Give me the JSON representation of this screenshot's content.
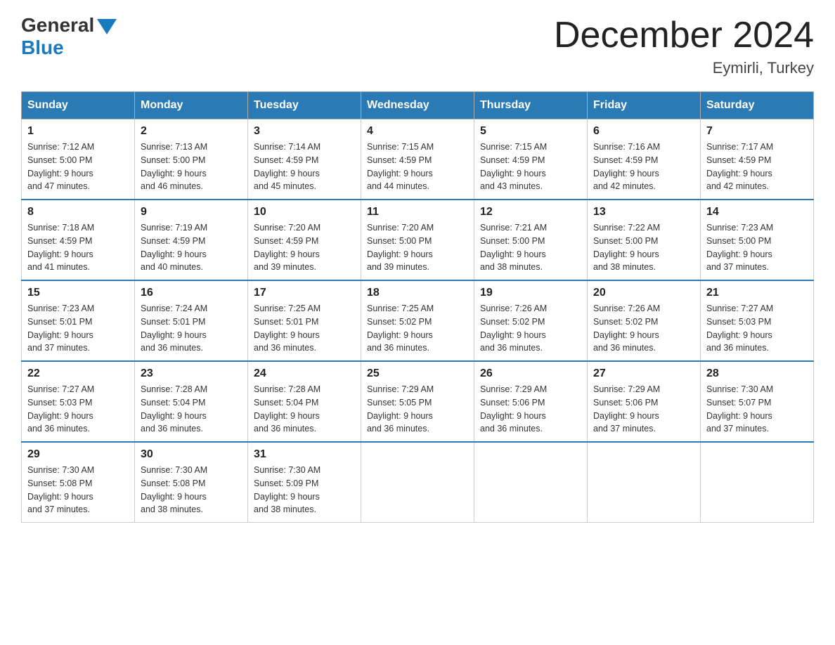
{
  "header": {
    "logo_general": "General",
    "logo_blue": "Blue",
    "main_title": "December 2024",
    "subtitle": "Eymirli, Turkey"
  },
  "days_of_week": [
    "Sunday",
    "Monday",
    "Tuesday",
    "Wednesday",
    "Thursday",
    "Friday",
    "Saturday"
  ],
  "weeks": [
    [
      {
        "date": "1",
        "sunrise": "7:12 AM",
        "sunset": "5:00 PM",
        "daylight": "9 hours and 47 minutes."
      },
      {
        "date": "2",
        "sunrise": "7:13 AM",
        "sunset": "5:00 PM",
        "daylight": "9 hours and 46 minutes."
      },
      {
        "date": "3",
        "sunrise": "7:14 AM",
        "sunset": "4:59 PM",
        "daylight": "9 hours and 45 minutes."
      },
      {
        "date": "4",
        "sunrise": "7:15 AM",
        "sunset": "4:59 PM",
        "daylight": "9 hours and 44 minutes."
      },
      {
        "date": "5",
        "sunrise": "7:15 AM",
        "sunset": "4:59 PM",
        "daylight": "9 hours and 43 minutes."
      },
      {
        "date": "6",
        "sunrise": "7:16 AM",
        "sunset": "4:59 PM",
        "daylight": "9 hours and 42 minutes."
      },
      {
        "date": "7",
        "sunrise": "7:17 AM",
        "sunset": "4:59 PM",
        "daylight": "9 hours and 42 minutes."
      }
    ],
    [
      {
        "date": "8",
        "sunrise": "7:18 AM",
        "sunset": "4:59 PM",
        "daylight": "9 hours and 41 minutes."
      },
      {
        "date": "9",
        "sunrise": "7:19 AM",
        "sunset": "4:59 PM",
        "daylight": "9 hours and 40 minutes."
      },
      {
        "date": "10",
        "sunrise": "7:20 AM",
        "sunset": "4:59 PM",
        "daylight": "9 hours and 39 minutes."
      },
      {
        "date": "11",
        "sunrise": "7:20 AM",
        "sunset": "5:00 PM",
        "daylight": "9 hours and 39 minutes."
      },
      {
        "date": "12",
        "sunrise": "7:21 AM",
        "sunset": "5:00 PM",
        "daylight": "9 hours and 38 minutes."
      },
      {
        "date": "13",
        "sunrise": "7:22 AM",
        "sunset": "5:00 PM",
        "daylight": "9 hours and 38 minutes."
      },
      {
        "date": "14",
        "sunrise": "7:23 AM",
        "sunset": "5:00 PM",
        "daylight": "9 hours and 37 minutes."
      }
    ],
    [
      {
        "date": "15",
        "sunrise": "7:23 AM",
        "sunset": "5:01 PM",
        "daylight": "9 hours and 37 minutes."
      },
      {
        "date": "16",
        "sunrise": "7:24 AM",
        "sunset": "5:01 PM",
        "daylight": "9 hours and 36 minutes."
      },
      {
        "date": "17",
        "sunrise": "7:25 AM",
        "sunset": "5:01 PM",
        "daylight": "9 hours and 36 minutes."
      },
      {
        "date": "18",
        "sunrise": "7:25 AM",
        "sunset": "5:02 PM",
        "daylight": "9 hours and 36 minutes."
      },
      {
        "date": "19",
        "sunrise": "7:26 AM",
        "sunset": "5:02 PM",
        "daylight": "9 hours and 36 minutes."
      },
      {
        "date": "20",
        "sunrise": "7:26 AM",
        "sunset": "5:02 PM",
        "daylight": "9 hours and 36 minutes."
      },
      {
        "date": "21",
        "sunrise": "7:27 AM",
        "sunset": "5:03 PM",
        "daylight": "9 hours and 36 minutes."
      }
    ],
    [
      {
        "date": "22",
        "sunrise": "7:27 AM",
        "sunset": "5:03 PM",
        "daylight": "9 hours and 36 minutes."
      },
      {
        "date": "23",
        "sunrise": "7:28 AM",
        "sunset": "5:04 PM",
        "daylight": "9 hours and 36 minutes."
      },
      {
        "date": "24",
        "sunrise": "7:28 AM",
        "sunset": "5:04 PM",
        "daylight": "9 hours and 36 minutes."
      },
      {
        "date": "25",
        "sunrise": "7:29 AM",
        "sunset": "5:05 PM",
        "daylight": "9 hours and 36 minutes."
      },
      {
        "date": "26",
        "sunrise": "7:29 AM",
        "sunset": "5:06 PM",
        "daylight": "9 hours and 36 minutes."
      },
      {
        "date": "27",
        "sunrise": "7:29 AM",
        "sunset": "5:06 PM",
        "daylight": "9 hours and 37 minutes."
      },
      {
        "date": "28",
        "sunrise": "7:30 AM",
        "sunset": "5:07 PM",
        "daylight": "9 hours and 37 minutes."
      }
    ],
    [
      {
        "date": "29",
        "sunrise": "7:30 AM",
        "sunset": "5:08 PM",
        "daylight": "9 hours and 37 minutes."
      },
      {
        "date": "30",
        "sunrise": "7:30 AM",
        "sunset": "5:08 PM",
        "daylight": "9 hours and 38 minutes."
      },
      {
        "date": "31",
        "sunrise": "7:30 AM",
        "sunset": "5:09 PM",
        "daylight": "9 hours and 38 minutes."
      },
      null,
      null,
      null,
      null
    ]
  ],
  "labels": {
    "sunrise_prefix": "Sunrise: ",
    "sunset_prefix": "Sunset: ",
    "daylight_prefix": "Daylight: "
  }
}
